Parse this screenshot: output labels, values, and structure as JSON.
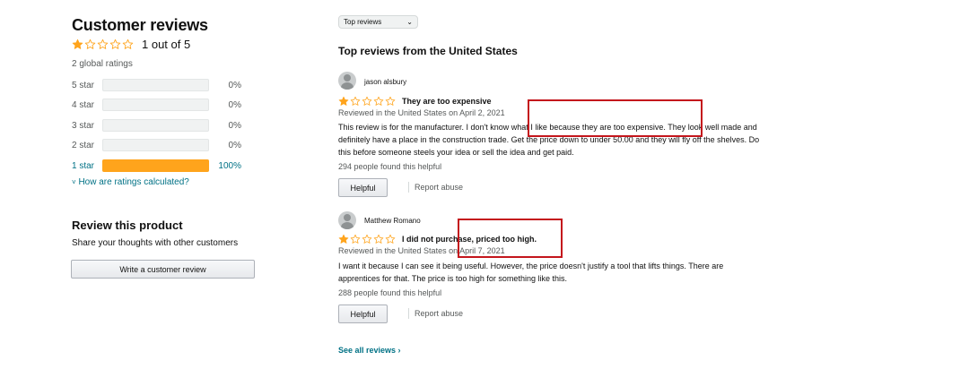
{
  "summary": {
    "title": "Customer reviews",
    "rating_text": "1 out of 5",
    "rating_value": 1,
    "global_ratings": "2 global ratings",
    "histogram": [
      {
        "label": "5 star",
        "pct_text": "0%",
        "pct": 0
      },
      {
        "label": "4 star",
        "pct_text": "0%",
        "pct": 0
      },
      {
        "label": "3 star",
        "pct_text": "0%",
        "pct": 0
      },
      {
        "label": "2 star",
        "pct_text": "0%",
        "pct": 0
      },
      {
        "label": "1 star",
        "pct_text": "100%",
        "pct": 100
      }
    ],
    "calc_link": "How are ratings calculated?"
  },
  "review_product": {
    "title": "Review this product",
    "subtitle": "Share your thoughts with other customers",
    "button": "Write a customer review"
  },
  "sort": {
    "selected": "Top reviews"
  },
  "reviews_section_title": "Top reviews from the United States",
  "reviews": [
    {
      "author": "jason alsbury",
      "rating": 1,
      "title": "They are too expensive",
      "date": "Reviewed in the United States on April 2, 2021",
      "body": "This review is for the manufacturer. I don't know what I like because they are too expensive. They look well made and definitely have a place in the construction trade. Get the price down to under 50.00 and they will fly off the shelves. Do this before someone steels your idea or sell the idea and get paid.",
      "helpful_count": "294 people found this helpful",
      "helpful_button": "Helpful",
      "report": "Report abuse"
    },
    {
      "author": "Matthew Romano",
      "rating": 1,
      "title": "I did not purchase, priced too high.",
      "date": "Reviewed in the United States on April 7, 2021",
      "body": "I want it because I can see it being useful. However, the price doesn't justify a tool that lifts things. There are apprentices for that. The price is too high for something like this.",
      "helpful_count": "288 people found this helpful",
      "helpful_button": "Helpful",
      "report": "Report abuse"
    }
  ],
  "see_all": "See all reviews ›",
  "colors": {
    "star": "#ffa41c",
    "link": "#007185",
    "annotation": "#c4161c"
  }
}
